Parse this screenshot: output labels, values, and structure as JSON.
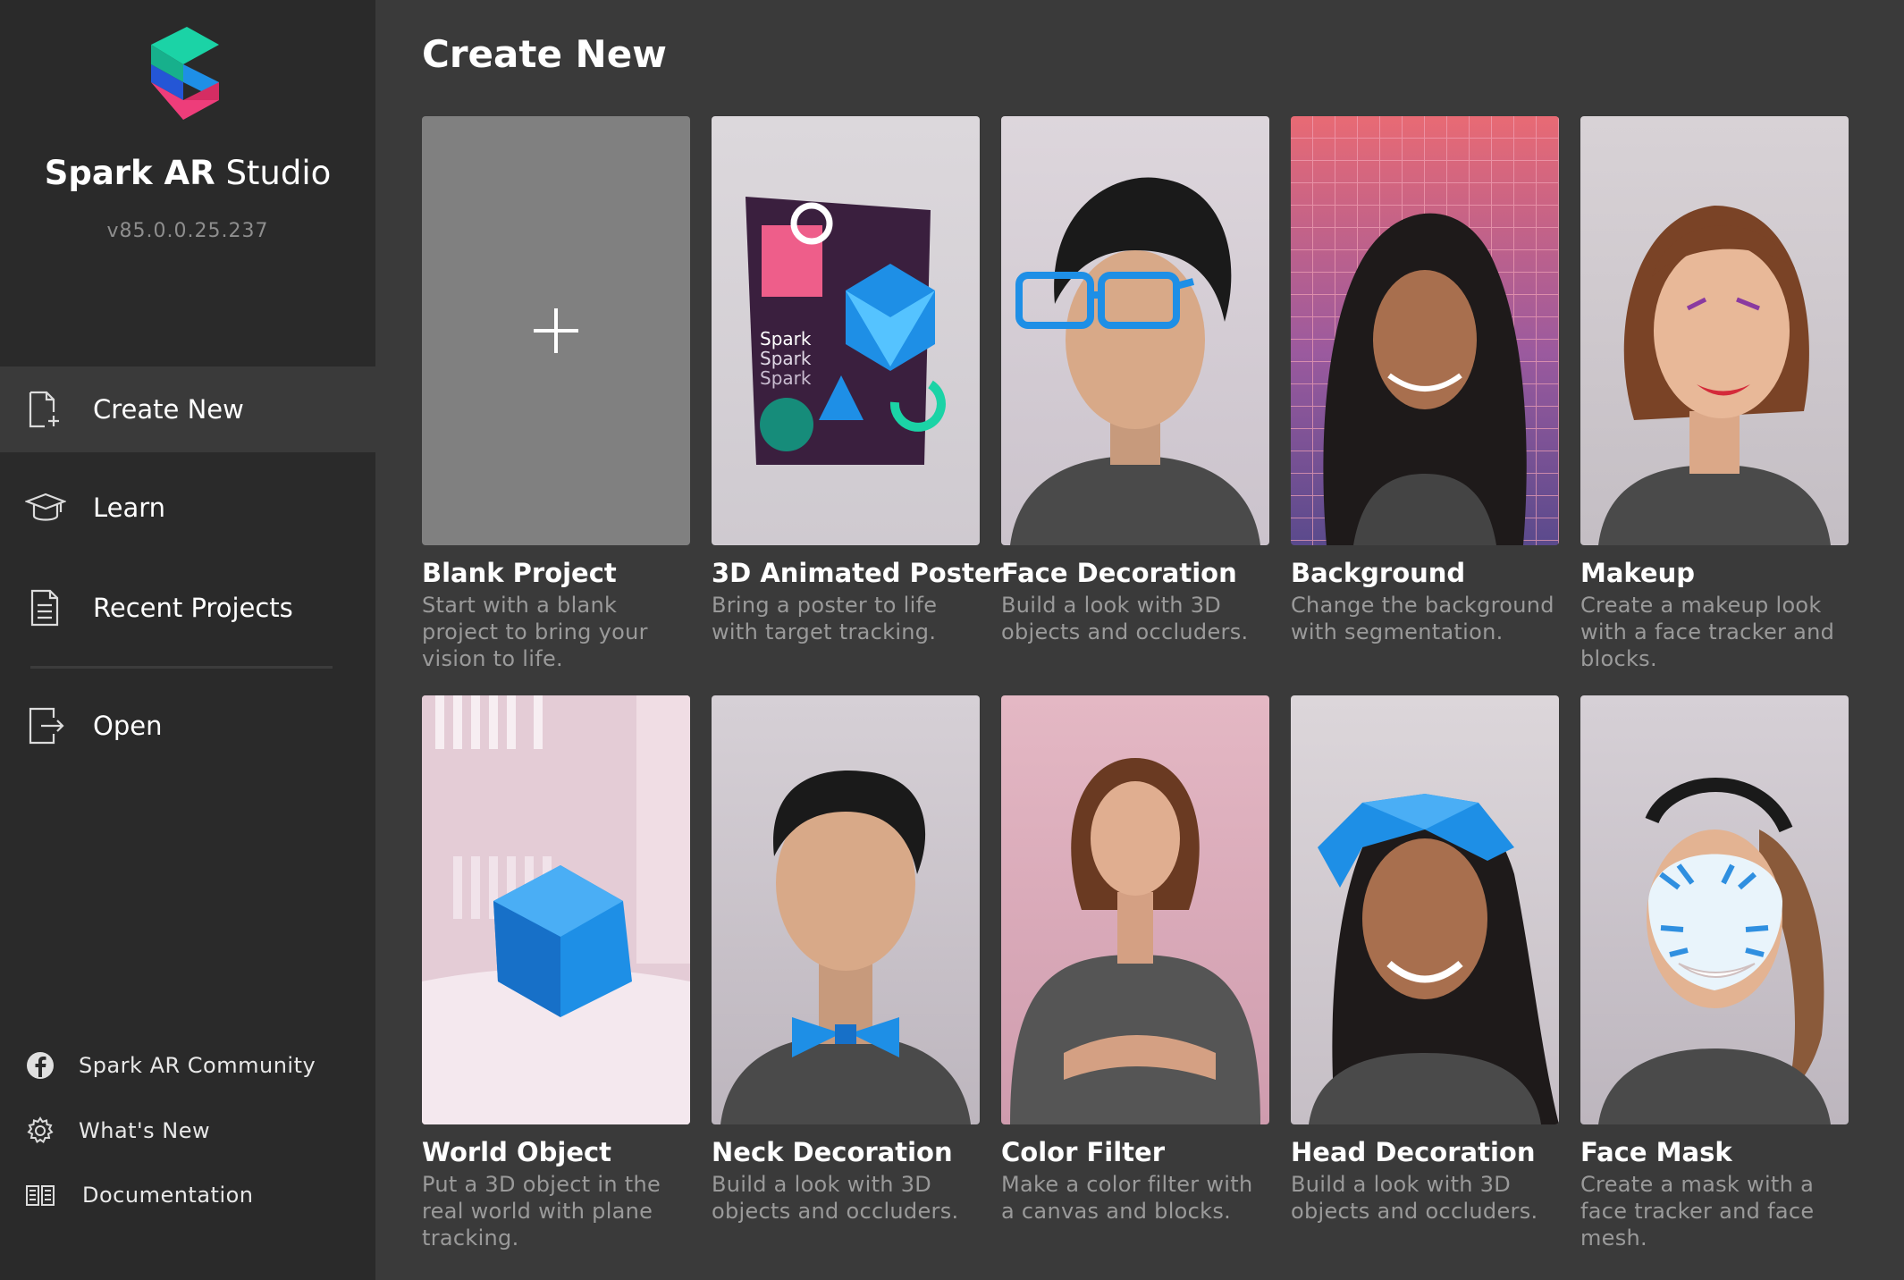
{
  "app": {
    "brand_bold": "Spark AR",
    "brand_light": "Studio",
    "version": "v85.0.0.25.237"
  },
  "nav": [
    {
      "label": "Create New",
      "icon": "new-file-icon",
      "active": true
    },
    {
      "label": "Learn",
      "icon": "graduation-cap-icon",
      "active": false
    },
    {
      "label": "Recent Projects",
      "icon": "document-icon",
      "active": false
    },
    {
      "label": "Open",
      "icon": "open-file-icon",
      "active": false
    }
  ],
  "footer": [
    {
      "label": "Spark AR Community",
      "icon": "facebook-icon"
    },
    {
      "label": "What's New",
      "icon": "gear-icon"
    },
    {
      "label": "Documentation",
      "icon": "book-icon"
    }
  ],
  "main": {
    "title": "Create New",
    "templates": [
      {
        "title": "Blank Project",
        "desc": "Start with a blank project to bring your vision to life."
      },
      {
        "title": "3D Animated Poster",
        "desc": "Bring a poster to life with target tracking."
      },
      {
        "title": "Face Decoration",
        "desc": "Build a look with 3D objects and occluders."
      },
      {
        "title": "Background",
        "desc": "Change the background with segmentation."
      },
      {
        "title": "Makeup",
        "desc": "Create a makeup look with a face tracker and blocks."
      },
      {
        "title": "World Object",
        "desc": "Put a 3D object in the real world with plane tracking."
      },
      {
        "title": "Neck Decoration",
        "desc": "Build a look with 3D objects and occluders."
      },
      {
        "title": "Color Filter",
        "desc": "Make a color filter with a canvas and blocks."
      },
      {
        "title": "Head Decoration",
        "desc": "Build a look with 3D objects and occluders."
      },
      {
        "title": "Face Mask",
        "desc": "Create a mask with a face tracker and face mesh."
      }
    ],
    "poster_text": [
      "Spark",
      "Spark",
      "Spark"
    ]
  },
  "colors": {
    "sidebar_bg": "#2a2a2a",
    "main_bg": "#3a3a3a",
    "accent_blue": "#1e8fe6",
    "logo_teal": "#1bd3a6",
    "logo_pink": "#ee3d7a"
  }
}
